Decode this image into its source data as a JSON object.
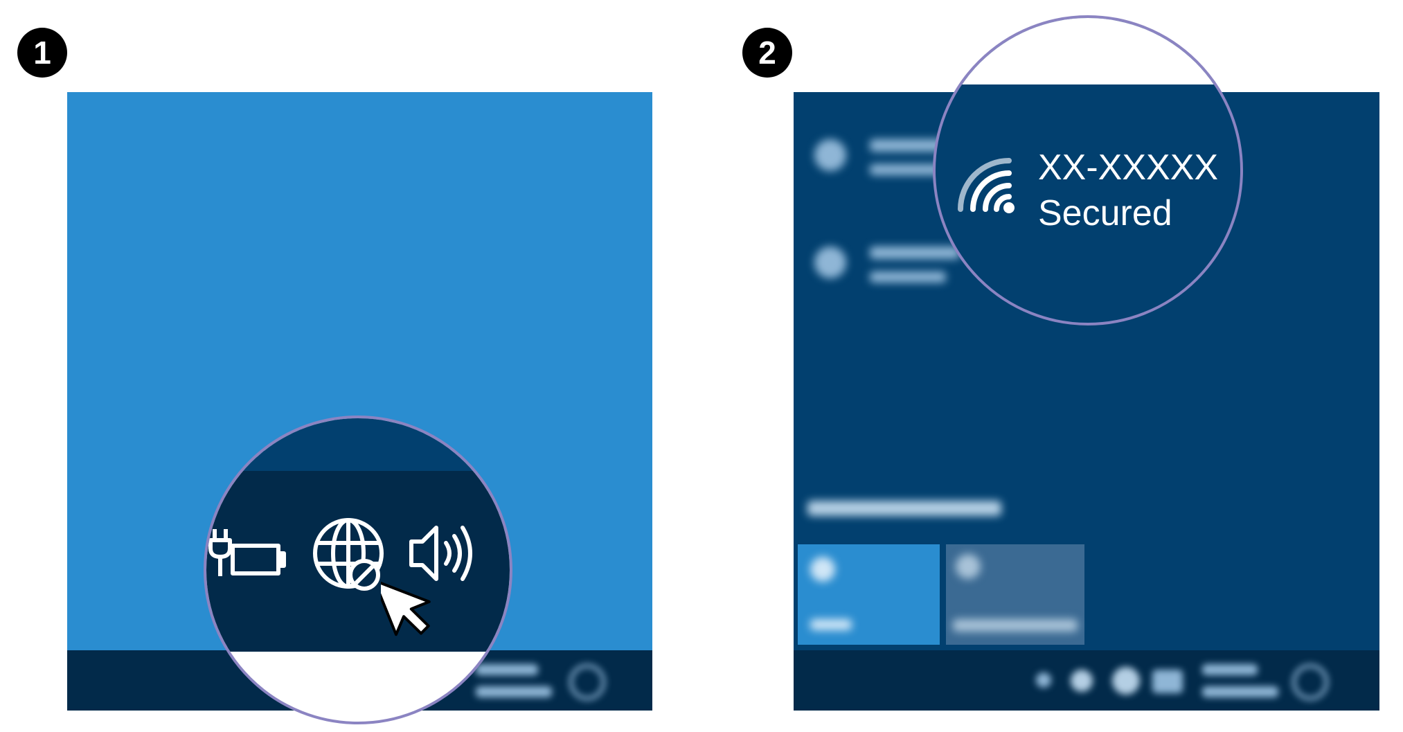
{
  "steps": [
    {
      "number": "1"
    },
    {
      "number": "2"
    }
  ],
  "panel1": {
    "tray_icons": [
      "battery-charging-icon",
      "network-disconnected-icon",
      "volume-icon"
    ],
    "pointer": "mouse-cursor-icon",
    "colors": {
      "desktop": "#2a8dd0",
      "taskbar": "#022a4a",
      "accent_ring": "#8b84c2"
    }
  },
  "panel2": {
    "network": {
      "name": "XX-XXXXX",
      "status": "Secured",
      "icon": "wifi-icon"
    },
    "colors": {
      "flyout": "#02406f",
      "active_tile": "#2a8dd0",
      "inactive_tile": "#3b6a93"
    }
  }
}
